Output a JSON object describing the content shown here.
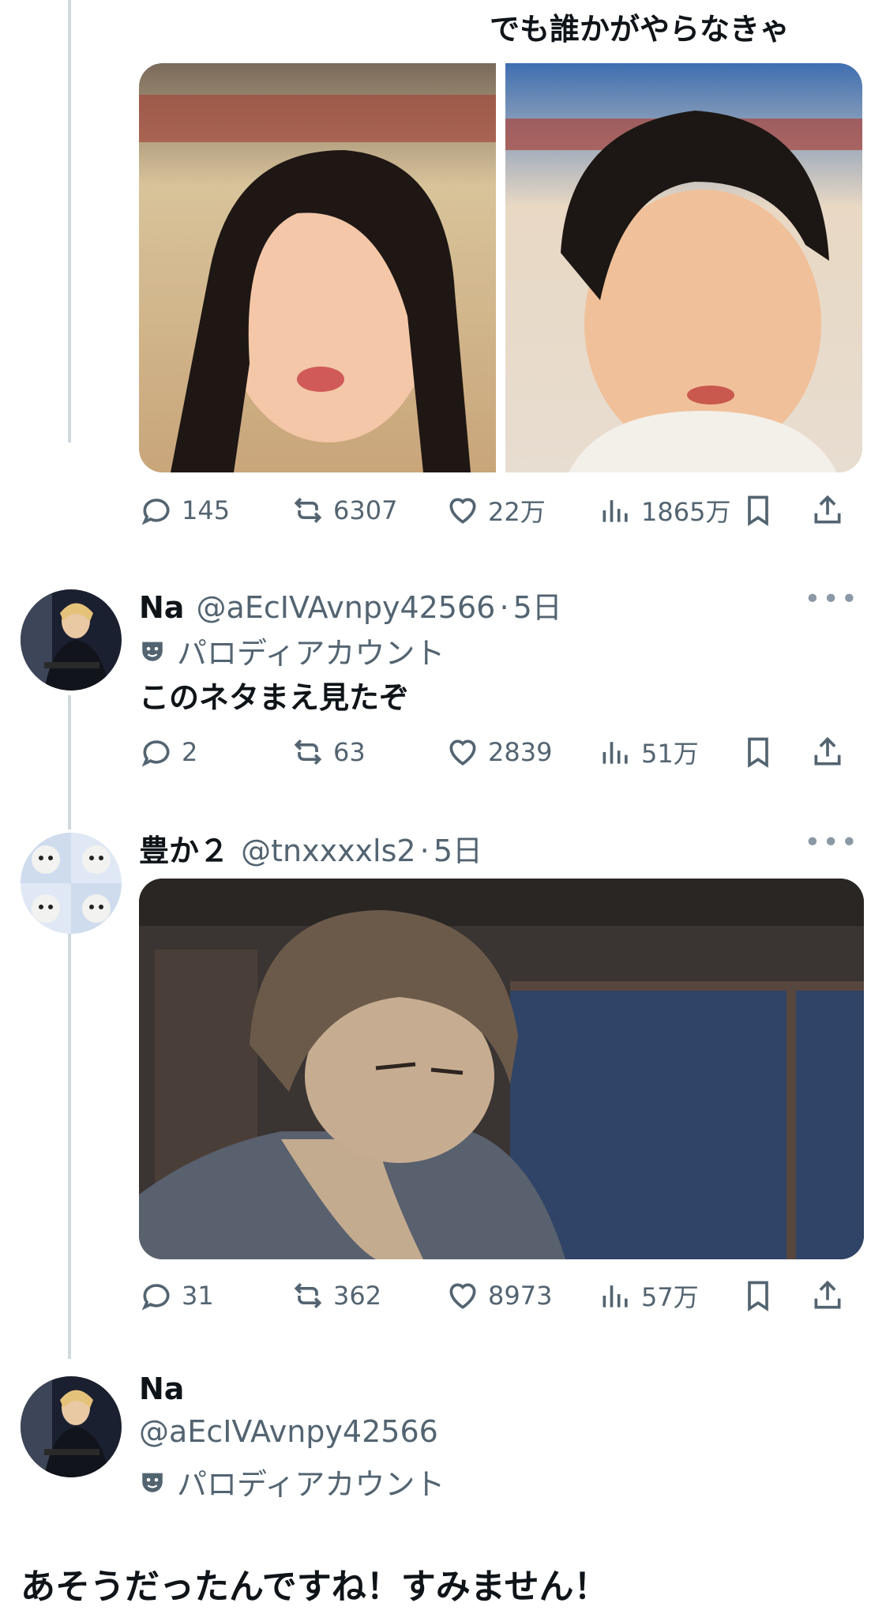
{
  "quoted_text": "でも誰かがやらなきゃ",
  "tweets": [
    {
      "metrics": {
        "replies": "145",
        "reposts": "6307",
        "likes": "22万",
        "views": "1865万"
      }
    },
    {
      "name": "Na",
      "handle": "@aEcIVAvnpy42566",
      "time": "5日",
      "badge": "パロディアカウント",
      "text": "このネタまえ見たぞ",
      "metrics": {
        "replies": "2",
        "reposts": "63",
        "likes": "2839",
        "views": "51万"
      }
    },
    {
      "name": "豊か２",
      "handle": "@tnxxxxls2",
      "time": "5日",
      "metrics": {
        "replies": "31",
        "reposts": "362",
        "likes": "8973",
        "views": "57万"
      }
    }
  ],
  "reply_author": {
    "name": "Na",
    "handle": "@aEcIVAvnpy42566",
    "badge": "パロディアカウント"
  },
  "main_text": "あそうだったんですね！すみません！",
  "separator": "·",
  "more_glyph": "•••",
  "colors": {
    "text": "#0f1419",
    "secondary": "#536471",
    "thread_line": "#cfd9de"
  },
  "icons": [
    "reply-icon",
    "repost-icon",
    "like-icon",
    "views-icon",
    "bookmark-icon",
    "share-icon",
    "parody-mask-icon",
    "more-icon"
  ]
}
